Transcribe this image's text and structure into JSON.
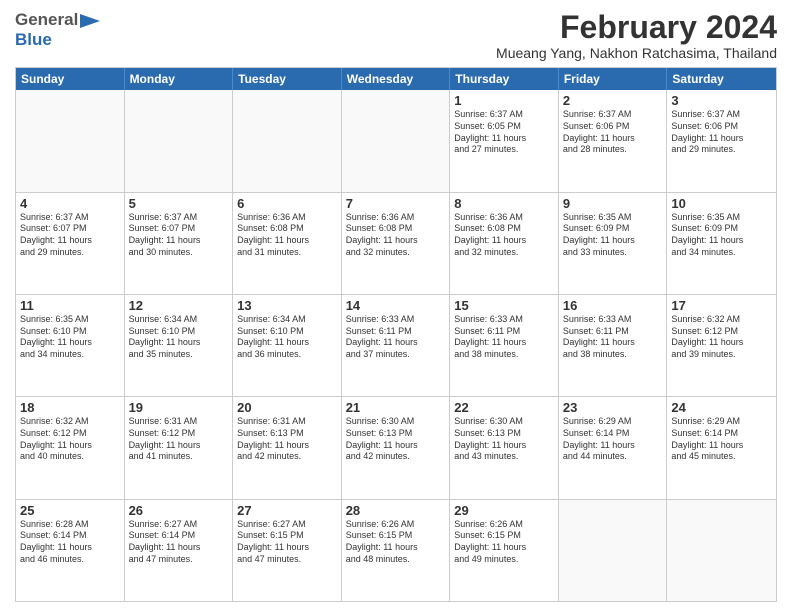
{
  "logo": {
    "general": "General",
    "blue": "Blue"
  },
  "title": "February 2024",
  "subtitle": "Mueang Yang, Nakhon Ratchasima, Thailand",
  "days": [
    "Sunday",
    "Monday",
    "Tuesday",
    "Wednesday",
    "Thursday",
    "Friday",
    "Saturday"
  ],
  "weeks": [
    [
      {
        "day": "",
        "info": ""
      },
      {
        "day": "",
        "info": ""
      },
      {
        "day": "",
        "info": ""
      },
      {
        "day": "",
        "info": ""
      },
      {
        "day": "1",
        "info": "Sunrise: 6:37 AM\nSunset: 6:05 PM\nDaylight: 11 hours\nand 27 minutes."
      },
      {
        "day": "2",
        "info": "Sunrise: 6:37 AM\nSunset: 6:06 PM\nDaylight: 11 hours\nand 28 minutes."
      },
      {
        "day": "3",
        "info": "Sunrise: 6:37 AM\nSunset: 6:06 PM\nDaylight: 11 hours\nand 29 minutes."
      }
    ],
    [
      {
        "day": "4",
        "info": "Sunrise: 6:37 AM\nSunset: 6:07 PM\nDaylight: 11 hours\nand 29 minutes."
      },
      {
        "day": "5",
        "info": "Sunrise: 6:37 AM\nSunset: 6:07 PM\nDaylight: 11 hours\nand 30 minutes."
      },
      {
        "day": "6",
        "info": "Sunrise: 6:36 AM\nSunset: 6:08 PM\nDaylight: 11 hours\nand 31 minutes."
      },
      {
        "day": "7",
        "info": "Sunrise: 6:36 AM\nSunset: 6:08 PM\nDaylight: 11 hours\nand 32 minutes."
      },
      {
        "day": "8",
        "info": "Sunrise: 6:36 AM\nSunset: 6:08 PM\nDaylight: 11 hours\nand 32 minutes."
      },
      {
        "day": "9",
        "info": "Sunrise: 6:35 AM\nSunset: 6:09 PM\nDaylight: 11 hours\nand 33 minutes."
      },
      {
        "day": "10",
        "info": "Sunrise: 6:35 AM\nSunset: 6:09 PM\nDaylight: 11 hours\nand 34 minutes."
      }
    ],
    [
      {
        "day": "11",
        "info": "Sunrise: 6:35 AM\nSunset: 6:10 PM\nDaylight: 11 hours\nand 34 minutes."
      },
      {
        "day": "12",
        "info": "Sunrise: 6:34 AM\nSunset: 6:10 PM\nDaylight: 11 hours\nand 35 minutes."
      },
      {
        "day": "13",
        "info": "Sunrise: 6:34 AM\nSunset: 6:10 PM\nDaylight: 11 hours\nand 36 minutes."
      },
      {
        "day": "14",
        "info": "Sunrise: 6:33 AM\nSunset: 6:11 PM\nDaylight: 11 hours\nand 37 minutes."
      },
      {
        "day": "15",
        "info": "Sunrise: 6:33 AM\nSunset: 6:11 PM\nDaylight: 11 hours\nand 38 minutes."
      },
      {
        "day": "16",
        "info": "Sunrise: 6:33 AM\nSunset: 6:11 PM\nDaylight: 11 hours\nand 38 minutes."
      },
      {
        "day": "17",
        "info": "Sunrise: 6:32 AM\nSunset: 6:12 PM\nDaylight: 11 hours\nand 39 minutes."
      }
    ],
    [
      {
        "day": "18",
        "info": "Sunrise: 6:32 AM\nSunset: 6:12 PM\nDaylight: 11 hours\nand 40 minutes."
      },
      {
        "day": "19",
        "info": "Sunrise: 6:31 AM\nSunset: 6:12 PM\nDaylight: 11 hours\nand 41 minutes."
      },
      {
        "day": "20",
        "info": "Sunrise: 6:31 AM\nSunset: 6:13 PM\nDaylight: 11 hours\nand 42 minutes."
      },
      {
        "day": "21",
        "info": "Sunrise: 6:30 AM\nSunset: 6:13 PM\nDaylight: 11 hours\nand 42 minutes."
      },
      {
        "day": "22",
        "info": "Sunrise: 6:30 AM\nSunset: 6:13 PM\nDaylight: 11 hours\nand 43 minutes."
      },
      {
        "day": "23",
        "info": "Sunrise: 6:29 AM\nSunset: 6:14 PM\nDaylight: 11 hours\nand 44 minutes."
      },
      {
        "day": "24",
        "info": "Sunrise: 6:29 AM\nSunset: 6:14 PM\nDaylight: 11 hours\nand 45 minutes."
      }
    ],
    [
      {
        "day": "25",
        "info": "Sunrise: 6:28 AM\nSunset: 6:14 PM\nDaylight: 11 hours\nand 46 minutes."
      },
      {
        "day": "26",
        "info": "Sunrise: 6:27 AM\nSunset: 6:14 PM\nDaylight: 11 hours\nand 47 minutes."
      },
      {
        "day": "27",
        "info": "Sunrise: 6:27 AM\nSunset: 6:15 PM\nDaylight: 11 hours\nand 47 minutes."
      },
      {
        "day": "28",
        "info": "Sunrise: 6:26 AM\nSunset: 6:15 PM\nDaylight: 11 hours\nand 48 minutes."
      },
      {
        "day": "29",
        "info": "Sunrise: 6:26 AM\nSunset: 6:15 PM\nDaylight: 11 hours\nand 49 minutes."
      },
      {
        "day": "",
        "info": ""
      },
      {
        "day": "",
        "info": ""
      }
    ]
  ]
}
